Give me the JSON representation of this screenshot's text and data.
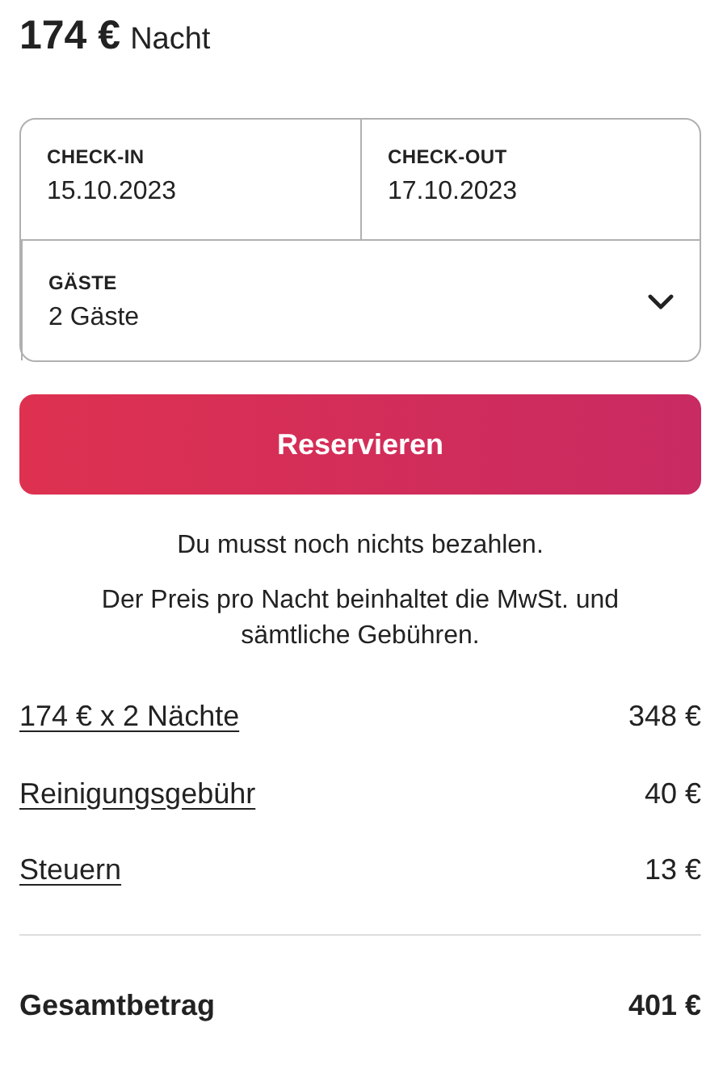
{
  "price": {
    "amount": "174 €",
    "unit": "Nacht"
  },
  "booking": {
    "check_in": {
      "label": "CHECK-IN",
      "value": "15.10.2023"
    },
    "check_out": {
      "label": "CHECK-OUT",
      "value": "17.10.2023"
    },
    "guests": {
      "label": "GÄSTE",
      "value": "2 Gäste"
    }
  },
  "reserve_button": "Reservieren",
  "notes": [
    "Du musst noch nichts bezahlen.",
    "Der Preis pro Nacht beinhaltet die MwSt. und sämtliche Gebühren."
  ],
  "line_items": [
    {
      "label": "174 € x 2 Nächte",
      "amount": "348 €"
    },
    {
      "label": "Reinigungsgebühr",
      "amount": "40 €"
    },
    {
      "label": "Steuern",
      "amount": "13 €"
    }
  ],
  "total": {
    "label": "Gesamtbetrag",
    "amount": "401 €"
  }
}
